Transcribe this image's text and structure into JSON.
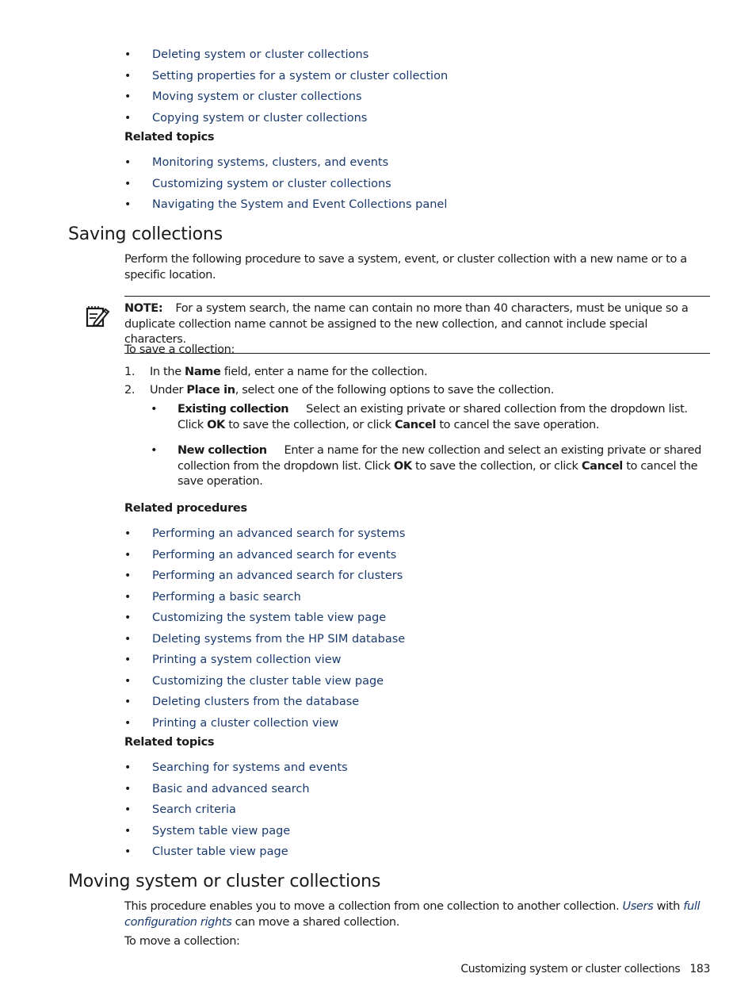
{
  "top_links": [
    "Deleting system or cluster collections",
    "Setting properties for a system or cluster collection",
    "Moving system or cluster collections",
    "Copying system or cluster collections"
  ],
  "top_related_heading": "Related topics",
  "top_related": [
    "Monitoring systems, clusters, and events",
    "Customizing system or cluster collections",
    "Navigating the System and Event Collections panel"
  ],
  "saving": {
    "title": "Saving collections",
    "intro": "Perform the following procedure to save a system, event, or cluster collection with a new name or to a specific location.",
    "note_label": "NOTE:",
    "note_text": "For a system search, the name can contain no more than 40 characters, must be unique so a duplicate collection name cannot be assigned to the new collection, and cannot include special characters.",
    "lead": "To save a collection:",
    "steps": [
      {
        "num": "1.",
        "pre": "In the ",
        "bold": "Name",
        "post": " field, enter a name for the collection."
      },
      {
        "num": "2.",
        "pre": "Under ",
        "bold": "Place in",
        "post": ", select one of the following options to save the collection."
      }
    ],
    "options": [
      {
        "term": "Existing collection",
        "t1": "Select an existing private or shared collection from the dropdown list. Click ",
        "b1": "OK",
        "t2": " to save the collection, or click ",
        "b2": "Cancel",
        "t3": " to cancel the save operation."
      },
      {
        "term": "New collection",
        "t1": "Enter a name for the new collection and select an existing private or shared collection from the dropdown list. Click ",
        "b1": "OK",
        "t2": " to save the collection, or click ",
        "b2": "Cancel",
        "t3": " to cancel the save operation."
      }
    ],
    "related_procedures_heading": "Related procedures",
    "related_procedures": [
      "Performing an advanced search for systems",
      "Performing an advanced search for events",
      "Performing an advanced search for clusters",
      "Performing a basic search",
      "Customizing the system table view page",
      "Deleting systems from the HP SIM database",
      "Printing a system collection view",
      "Customizing the cluster table view page",
      "Deleting clusters from the database",
      "Printing a cluster collection view"
    ],
    "related_topics_heading": "Related topics",
    "related_topics": [
      "Searching for systems and events",
      "Basic and advanced search",
      "Search criteria",
      "System table view page",
      "Cluster table view page"
    ]
  },
  "moving": {
    "title": "Moving system or cluster collections",
    "p1": "This procedure enables you to move a collection from one collection to another collection. ",
    "link1": "Users",
    "p2": " with ",
    "link2": "full configuration rights",
    "p3": " can move a shared collection.",
    "lead": "To move a collection:"
  },
  "footer": {
    "section": "Customizing system or cluster collections",
    "page": "183"
  },
  "colors": {
    "link": "#1a3a6e",
    "text": "#1a1a1a"
  }
}
